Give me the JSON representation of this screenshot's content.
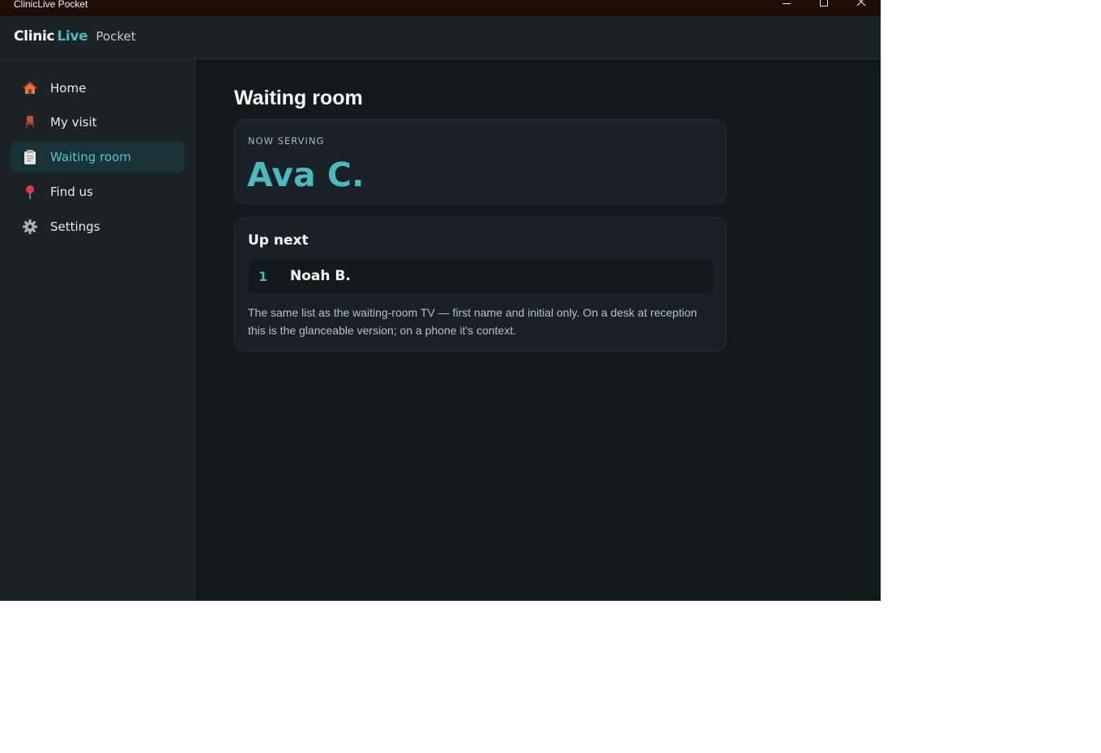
{
  "window": {
    "title": "ClinicLive Pocket"
  },
  "brand": {
    "part1": "Clinic",
    "part2": "Live",
    "product": "Pocket"
  },
  "colors": {
    "accent": "#4db8bd",
    "background": "#111a1d",
    "surface": "#1a2326",
    "titlebar": "#1e0c07"
  },
  "sidebar": {
    "items": [
      {
        "label": "Home",
        "icon": "house-icon"
      },
      {
        "label": "My visit",
        "icon": "chair-icon"
      },
      {
        "label": "Waiting room",
        "icon": "clipboard-icon",
        "active": true
      },
      {
        "label": "Find us",
        "icon": "map-pin-icon"
      },
      {
        "label": "Settings",
        "icon": "gear-icon"
      }
    ]
  },
  "main": {
    "title": "Waiting room",
    "now_serving": {
      "label": "NOW SERVING",
      "name": "Ava C."
    },
    "up_next": {
      "heading": "Up next",
      "queue": [
        {
          "position": "1",
          "name": "Noah B."
        }
      ],
      "note": "The same list as the waiting-room TV — first name and initial only. On a desk at reception this is the glanceable version; on a phone it's context."
    }
  }
}
